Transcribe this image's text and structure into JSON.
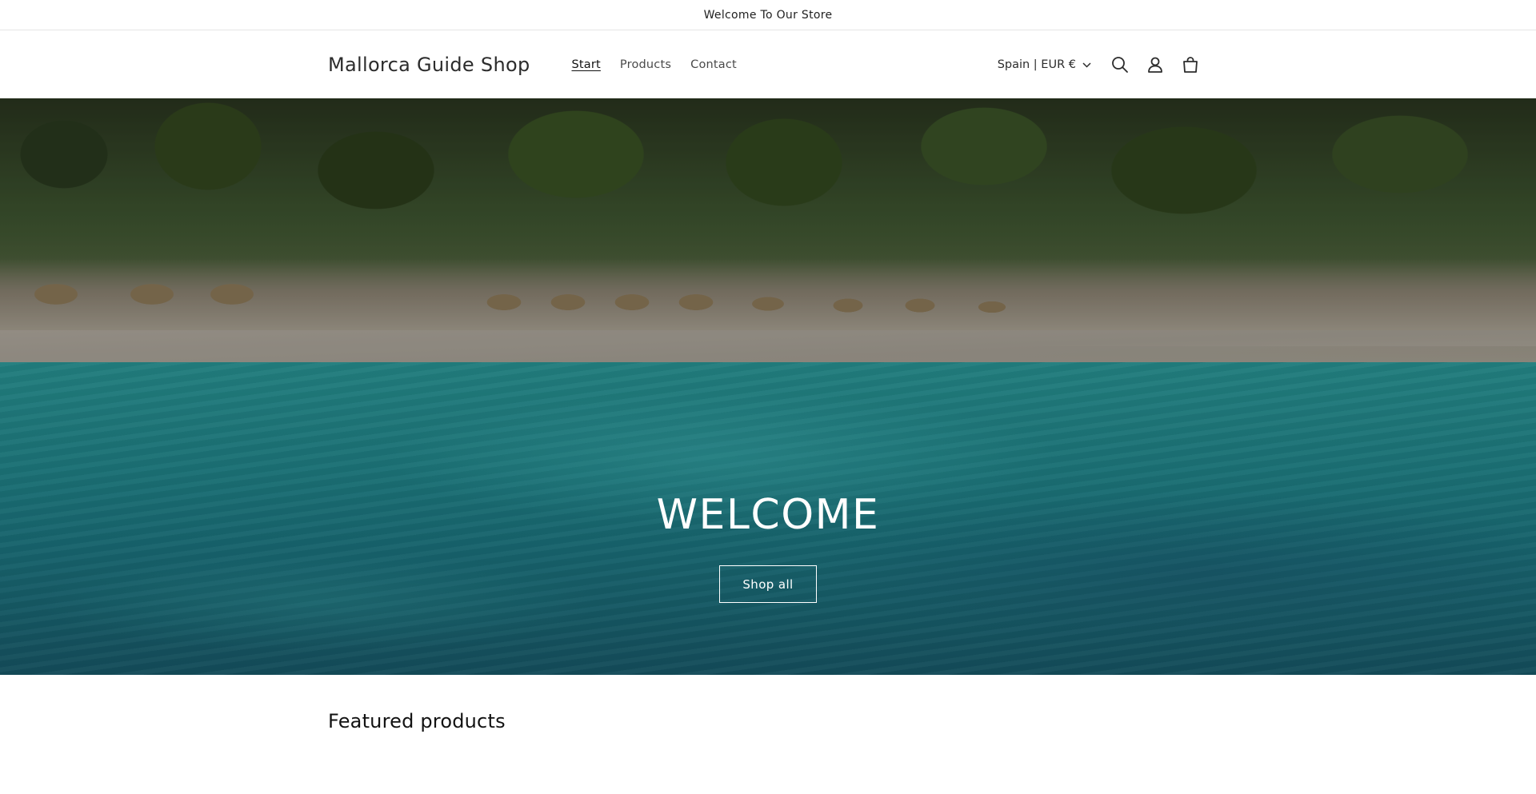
{
  "announcement": {
    "text": "Welcome To Our Store"
  },
  "header": {
    "logo": "Mallorca Guide Shop",
    "nav": [
      {
        "label": "Start",
        "active": true
      },
      {
        "label": "Products",
        "active": false
      },
      {
        "label": "Contact",
        "active": false
      }
    ],
    "locale": "Spain | EUR €",
    "icons": [
      "chevron-down-icon",
      "search-icon",
      "account-icon",
      "cart-icon"
    ]
  },
  "hero": {
    "title": "WELCOME",
    "button_label": "Shop all"
  },
  "featured": {
    "title": "Featured products"
  },
  "colors": {
    "text": "#121212",
    "muted": "#4a4a4a",
    "border": "#e6e6e6",
    "hero_text": "#ffffff"
  }
}
